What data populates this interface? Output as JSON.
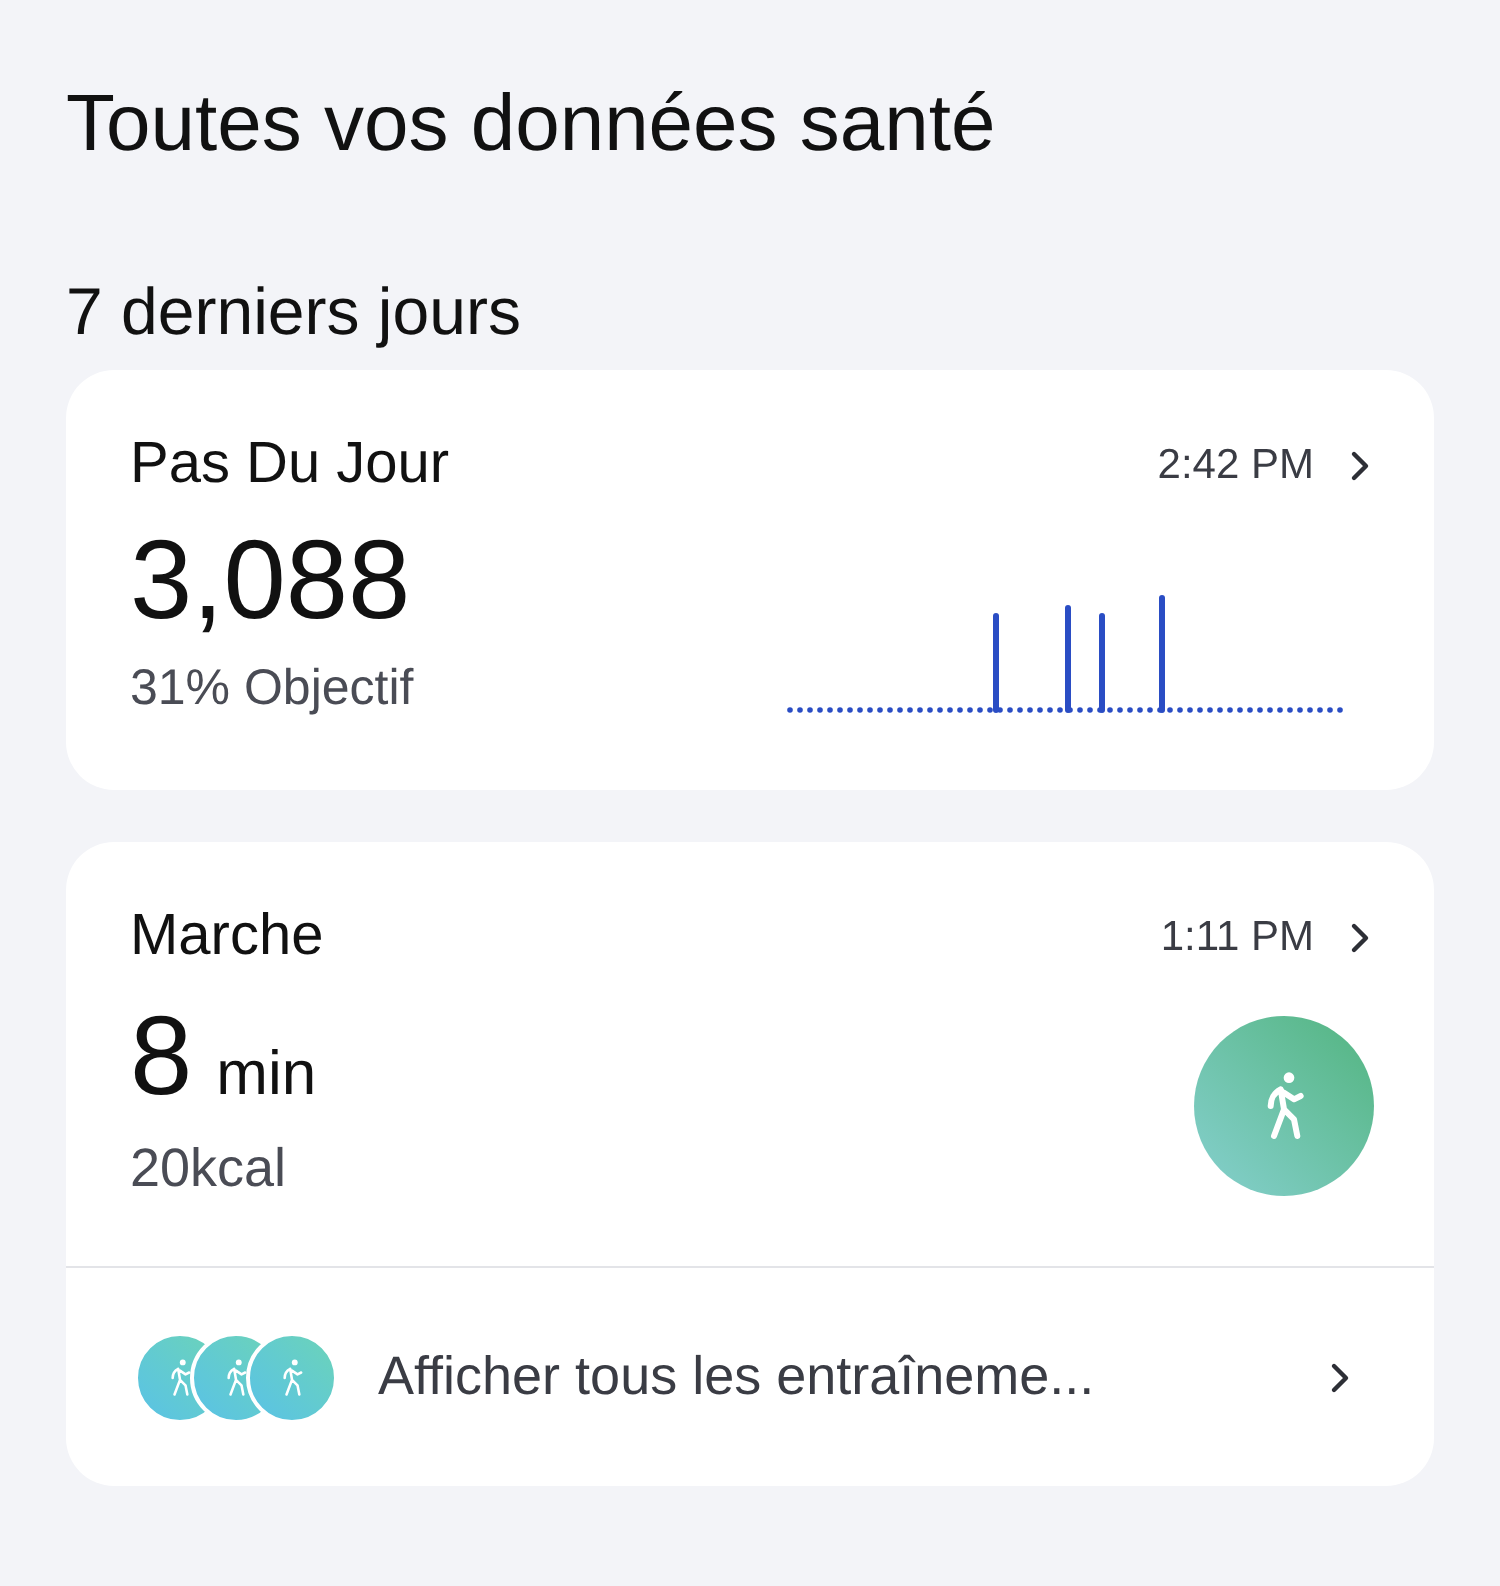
{
  "title": "Toutes vos données santé",
  "section": "7 derniers jours",
  "steps_card": {
    "title": "Pas Du Jour",
    "time": "2:42 PM",
    "value": "3,088",
    "goal": "31% Objectif"
  },
  "walk_card": {
    "title": "Marche",
    "time": "1:11 PM",
    "value": "8",
    "unit": "min",
    "calories": "20kcal",
    "all_workouts": "Afficher tous les entraîneme..."
  }
}
